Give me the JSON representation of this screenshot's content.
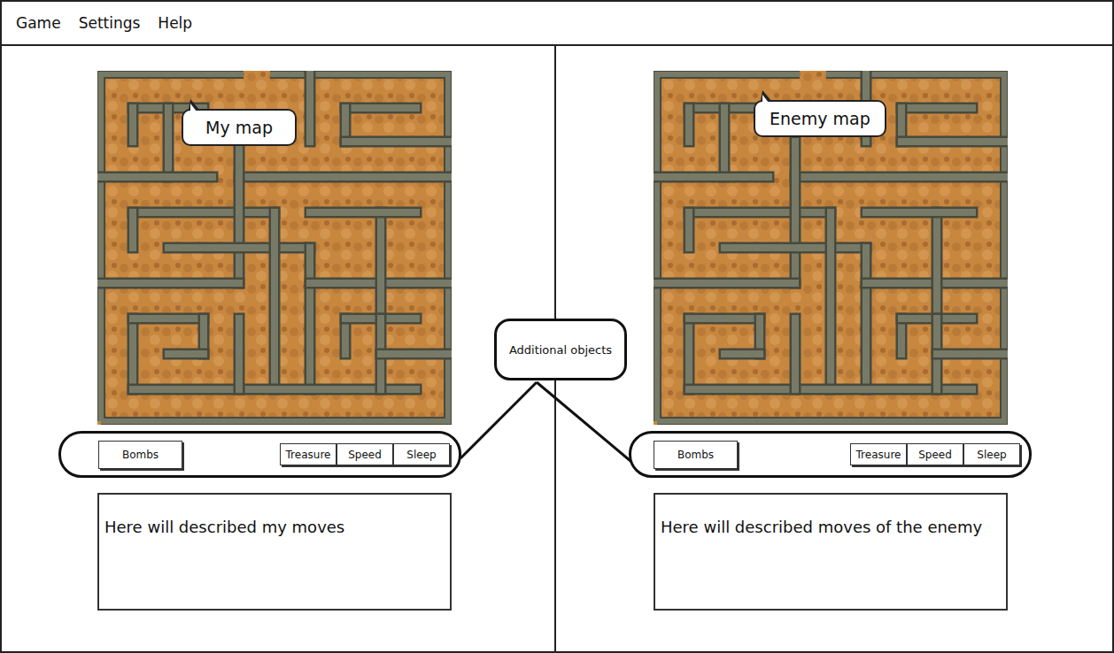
{
  "menu": [
    "Game",
    "Settings",
    "Help"
  ],
  "panels": [
    {
      "map_label": "My map",
      "bombs": "Bombs",
      "extras": [
        "Treasure",
        "Speed",
        "Sleep"
      ],
      "log": "Here will described my moves"
    },
    {
      "map_label": "Enemy map",
      "bombs": "Bombs",
      "extras": [
        "Treasure",
        "Speed",
        "Sleep"
      ],
      "log": "Here will described moves of the enemy"
    }
  ],
  "callout": "Additional objects"
}
